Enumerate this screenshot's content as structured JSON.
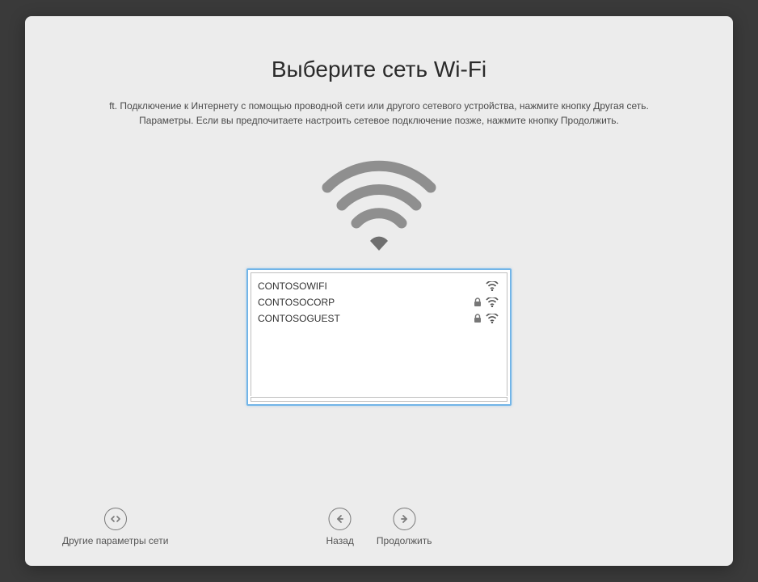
{
  "title": "Выберите сеть Wi-Fi",
  "subtitle_line1": "ft. Подключение к Интернету с помощью проводной сети или другого сетевого устройства, нажмите кнопку Другая сеть.",
  "subtitle_line2": "Параметры. Если вы предпочитаете настроить сетевое подключение позже, нажмите кнопку Продолжить.",
  "networks": [
    {
      "name": "CONTOSOWIFI",
      "locked": false
    },
    {
      "name": "CONTOSOCORP",
      "locked": true
    },
    {
      "name": "CONTOSOGUEST",
      "locked": true
    }
  ],
  "footer": {
    "other_options": "Другие параметры сети",
    "back": "Назад",
    "continue": "Продолжить"
  }
}
